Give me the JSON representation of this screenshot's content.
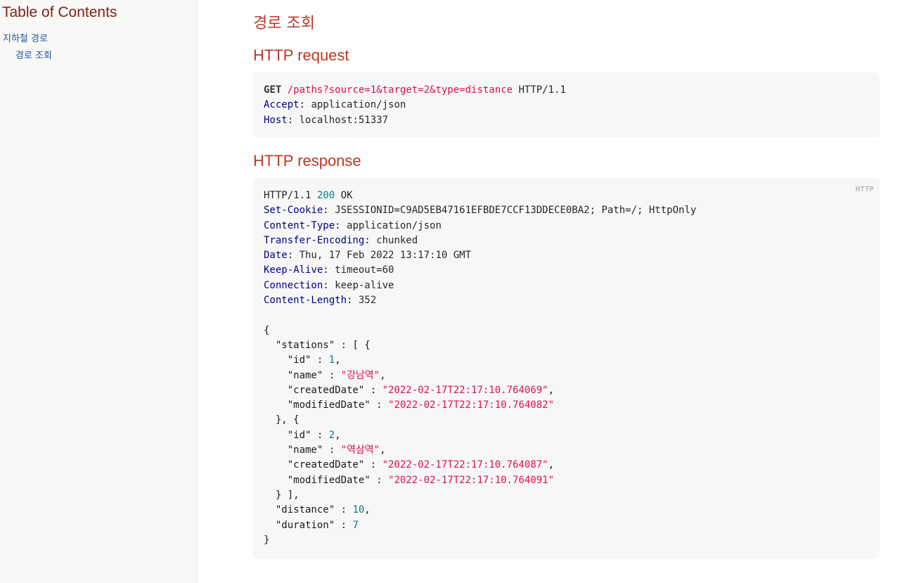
{
  "toc": {
    "title": "Table of Contents",
    "items": [
      {
        "label": "지하철 경로"
      },
      {
        "label": "경로 조회"
      }
    ]
  },
  "main": {
    "title": "경로 조회",
    "request": {
      "heading": "HTTP request",
      "method": "GET",
      "path": "/paths?source=1&target=2&type=distance",
      "protocol": "HTTP/1.1",
      "headers": [
        {
          "name": "Accept",
          "value": "application/json"
        },
        {
          "name": "Host",
          "value": "localhost:51337"
        }
      ]
    },
    "response": {
      "heading": "HTTP response",
      "lang_badge": "HTTP",
      "protocol": "HTTP/1.1",
      "status_code": "200",
      "status_text": "OK",
      "headers": [
        {
          "name": "Set-Cookie",
          "value": "JSESSIONID=C9AD5EB47161EFBDE7CCF13DDECE0BA2; Path=/; HttpOnly"
        },
        {
          "name": "Content-Type",
          "value": "application/json"
        },
        {
          "name": "Transfer-Encoding",
          "value": "chunked"
        },
        {
          "name": "Date",
          "value": "Thu, 17 Feb 2022 13:17:10 GMT"
        },
        {
          "name": "Keep-Alive",
          "value": "timeout=60"
        },
        {
          "name": "Connection",
          "value": "keep-alive"
        },
        {
          "name": "Content-Length",
          "value": "352"
        }
      ],
      "body": {
        "stations": [
          {
            "id": "1",
            "name": "\"강남역\"",
            "createdDate": "\"2022-02-17T22:17:10.764069\"",
            "modifiedDate": "\"2022-02-17T22:17:10.764082\""
          },
          {
            "id": "2",
            "name": "\"역삼역\"",
            "createdDate": "\"2022-02-17T22:17:10.764087\"",
            "modifiedDate": "\"2022-02-17T22:17:10.764091\""
          }
        ],
        "distance": "10",
        "duration": "7"
      }
    }
  }
}
